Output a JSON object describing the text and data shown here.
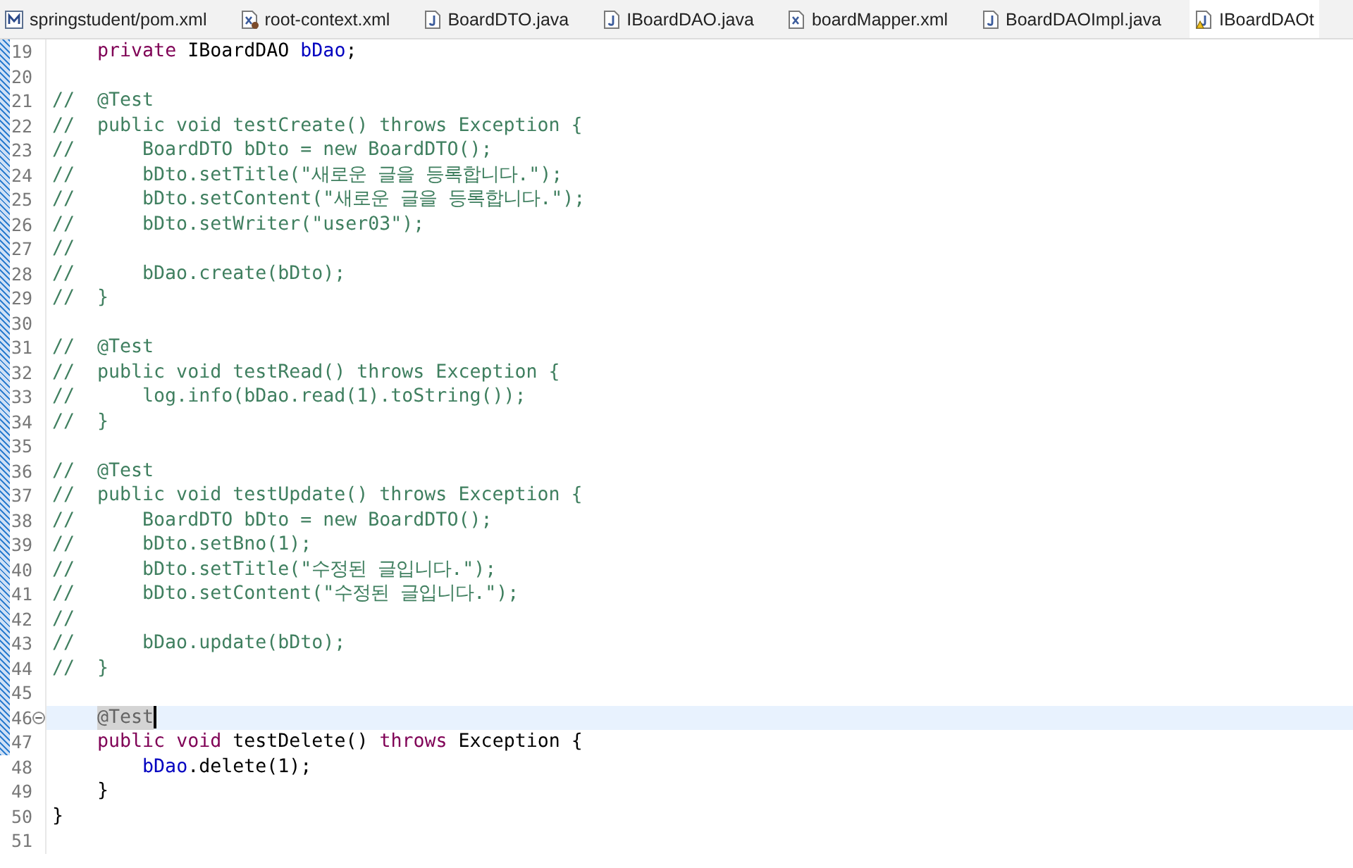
{
  "tabs": [
    {
      "label": "springstudent/pom.xml",
      "kind": "maven",
      "selected": false
    },
    {
      "label": "root-context.xml",
      "kind": "bean",
      "selected": false
    },
    {
      "label": "BoardDTO.java",
      "kind": "java",
      "selected": false
    },
    {
      "label": "IBoardDAO.java",
      "kind": "java",
      "selected": false
    },
    {
      "label": "boardMapper.xml",
      "kind": "xml",
      "selected": false
    },
    {
      "label": "BoardDAOImpl.java",
      "kind": "java",
      "selected": false
    },
    {
      "label": "IBoardDAOt",
      "kind": "warning",
      "selected": true
    }
  ],
  "lines": [
    {
      "number": "19",
      "current": false,
      "fold": false,
      "tokens": [
        {
          "text": "    private",
          "kind": "keyword"
        },
        {
          "text": " IBoardDAO",
          "kind": "plain"
        },
        {
          "text": " bDao",
          "kind": "field"
        },
        {
          "text": ";",
          "kind": "plain"
        }
      ]
    },
    {
      "number": "20",
      "current": false,
      "fold": false
    },
    {
      "number": "21",
      "current": false,
      "fold": false,
      "tokens": [
        {
          "text": "//  @Test",
          "kind": "comment"
        }
      ]
    },
    {
      "number": "22",
      "current": false,
      "fold": false,
      "tokens": [
        {
          "text": "//  public void testCreate() throws Exception {",
          "kind": "comment"
        }
      ]
    },
    {
      "number": "23",
      "current": false,
      "fold": false,
      "tokens": [
        {
          "text": "//      BoardDTO bDto = new BoardDTO();",
          "kind": "comment"
        }
      ]
    },
    {
      "number": "24",
      "current": false,
      "fold": false,
      "tokens": [
        {
          "text": "//      bDto.setTitle(\"새로운 글을 등록합니다.\");",
          "kind": "comment"
        }
      ]
    },
    {
      "number": "25",
      "current": false,
      "fold": false,
      "tokens": [
        {
          "text": "//      bDto.setContent(\"새로운 글을 등록합니다.\");",
          "kind": "comment"
        }
      ]
    },
    {
      "number": "26",
      "current": false,
      "fold": false,
      "tokens": [
        {
          "text": "//      bDto.setWriter(\"user03\");",
          "kind": "comment"
        }
      ]
    },
    {
      "number": "27",
      "current": false,
      "fold": false,
      "tokens": [
        {
          "text": "//",
          "kind": "comment"
        }
      ]
    },
    {
      "number": "28",
      "current": false,
      "fold": false,
      "tokens": [
        {
          "text": "//      bDao.create(bDto);",
          "kind": "comment"
        }
      ]
    },
    {
      "number": "29",
      "current": false,
      "fold": false,
      "tokens": [
        {
          "text": "//  }",
          "kind": "comment"
        }
      ]
    },
    {
      "number": "30",
      "current": false,
      "fold": false
    },
    {
      "number": "31",
      "current": false,
      "fold": false,
      "tokens": [
        {
          "text": "//  @Test",
          "kind": "comment"
        }
      ]
    },
    {
      "number": "32",
      "current": false,
      "fold": false,
      "tokens": [
        {
          "text": "//  public void testRead() throws Exception {",
          "kind": "comment"
        }
      ]
    },
    {
      "number": "33",
      "current": false,
      "fold": false,
      "tokens": [
        {
          "text": "//      log.info(bDao.read(1).toString());",
          "kind": "comment"
        }
      ]
    },
    {
      "number": "34",
      "current": false,
      "fold": false,
      "tokens": [
        {
          "text": "//  }",
          "kind": "comment"
        }
      ]
    },
    {
      "number": "35",
      "current": false,
      "fold": false
    },
    {
      "number": "36",
      "current": false,
      "fold": false,
      "tokens": [
        {
          "text": "//  @Test",
          "kind": "comment"
        }
      ]
    },
    {
      "number": "37",
      "current": false,
      "fold": false,
      "tokens": [
        {
          "text": "//  public void testUpdate() throws Exception {",
          "kind": "comment"
        }
      ]
    },
    {
      "number": "38",
      "current": false,
      "fold": false,
      "tokens": [
        {
          "text": "//      BoardDTO bDto = new BoardDTO();",
          "kind": "comment"
        }
      ]
    },
    {
      "number": "39",
      "current": false,
      "fold": false,
      "tokens": [
        {
          "text": "//      bDto.setBno(1);",
          "kind": "comment"
        }
      ]
    },
    {
      "number": "40",
      "current": false,
      "fold": false,
      "tokens": [
        {
          "text": "//      bDto.setTitle(\"수정된 글입니다.\");",
          "kind": "comment"
        }
      ]
    },
    {
      "number": "41",
      "current": false,
      "fold": false,
      "tokens": [
        {
          "text": "//      bDto.setContent(\"수정된 글입니다.\");",
          "kind": "comment"
        }
      ]
    },
    {
      "number": "42",
      "current": false,
      "fold": false,
      "tokens": [
        {
          "text": "//",
          "kind": "comment"
        }
      ]
    },
    {
      "number": "43",
      "current": false,
      "fold": false,
      "tokens": [
        {
          "text": "//      bDao.update(bDto);",
          "kind": "comment"
        }
      ]
    },
    {
      "number": "44",
      "current": false,
      "fold": false,
      "tokens": [
        {
          "text": "//  }",
          "kind": "comment"
        }
      ]
    },
    {
      "number": "45",
      "current": false,
      "fold": false
    },
    {
      "number": "46",
      "current": true,
      "fold": true,
      "tokens": [
        {
          "text": "    @Test",
          "kind": "occurrence"
        }
      ]
    },
    {
      "number": "47",
      "current": false,
      "fold": false,
      "tokens": [
        {
          "text": "    public",
          "kind": "keyword"
        },
        {
          "text": " void",
          "kind": "keyword"
        },
        {
          "text": " testDelete()",
          "kind": "plain"
        },
        {
          "text": " throws",
          "kind": "keyword"
        },
        {
          "text": " Exception {",
          "kind": "plain"
        }
      ]
    },
    {
      "number": "48",
      "current": false,
      "fold": false,
      "tokens": [
        {
          "text": "        bDao",
          "kind": "field"
        },
        {
          "text": ".delete(1);",
          "kind": "plain"
        }
      ]
    },
    {
      "number": "49",
      "current": false,
      "fold": false,
      "tokens": [
        {
          "text": "    }",
          "kind": "plain"
        }
      ]
    },
    {
      "number": "50",
      "current": false,
      "fold": false,
      "tokens": [
        {
          "text": "}",
          "kind": "plain"
        }
      ]
    },
    {
      "number": "51",
      "current": false,
      "fold": false
    }
  ]
}
